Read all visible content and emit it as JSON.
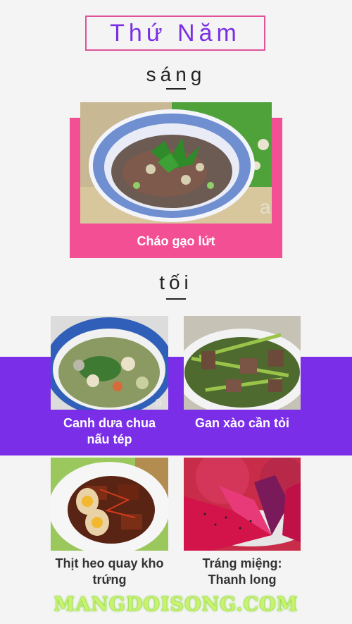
{
  "title": "Thứ Năm",
  "morning": {
    "label": "sáng",
    "dish": "Cháo gạo lứt"
  },
  "evening": {
    "label": "tối",
    "dishes": [
      {
        "caption": "Canh dưa chua nấu tép"
      },
      {
        "caption": "Gan xào cần tỏi"
      },
      {
        "caption": "Thịt heo quay kho trứng"
      },
      {
        "caption": "Tráng miệng: Thanh long"
      }
    ]
  },
  "watermark": "MANGDOISONG.COM",
  "colors": {
    "accent_pink": "#f24f95",
    "accent_purple": "#7b2ee8",
    "title_text": "#7a2ee6"
  }
}
